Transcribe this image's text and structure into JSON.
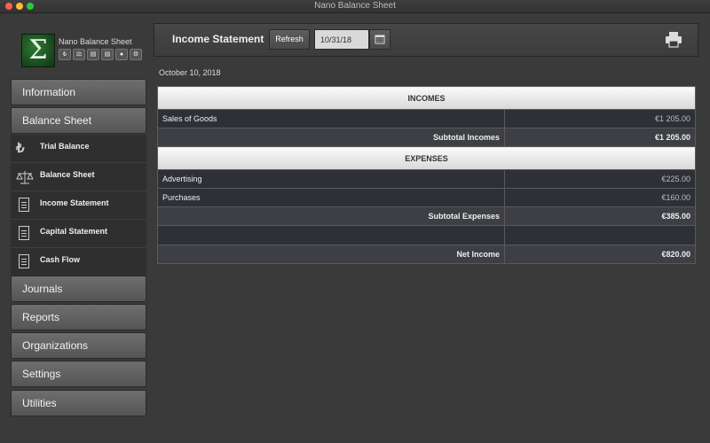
{
  "window": {
    "title": "Nano Balance Sheet"
  },
  "brand": {
    "name": "Nano Balance Sheet",
    "logo_glyph": "Σ"
  },
  "sidebar": {
    "sections": [
      {
        "label": "Information"
      },
      {
        "label": "Balance Sheet"
      },
      {
        "label": "Journals"
      },
      {
        "label": "Reports"
      },
      {
        "label": "Organizations"
      },
      {
        "label": "Settings"
      },
      {
        "label": "Utilities"
      }
    ],
    "sub_items": [
      {
        "label": "Trial Balance",
        "icon": "lira-icon"
      },
      {
        "label": "Balance Sheet",
        "icon": "scale-icon"
      },
      {
        "label": "Income Statement",
        "icon": "document-icon"
      },
      {
        "label": "Capital Statement",
        "icon": "document-icon"
      },
      {
        "label": "Cash Flow",
        "icon": "document-icon"
      }
    ]
  },
  "toolbar": {
    "title": "Income Statement",
    "refresh_label": "Refresh",
    "date_value": "10/31/18"
  },
  "report": {
    "date": "October 10, 2018",
    "incomes_header": "INCOMES",
    "incomes": [
      {
        "name": "Sales of Goods",
        "amount": "€1 205.00"
      }
    ],
    "subtotal_incomes_label": "Subtotal Incomes",
    "subtotal_incomes": "€1 205.00",
    "expenses_header": "EXPENSES",
    "expenses": [
      {
        "name": "Advertising",
        "amount": "€225.00"
      },
      {
        "name": "Purchases",
        "amount": "€160.00"
      }
    ],
    "subtotal_expenses_label": "Subtotal Expenses",
    "subtotal_expenses": "€385.00",
    "net_income_label": "Net Income",
    "net_income": "€820.00"
  },
  "colors": {
    "background": "#3a3a3a",
    "logo_green": "#2e7a35",
    "row_dark": "#2d3036"
  }
}
